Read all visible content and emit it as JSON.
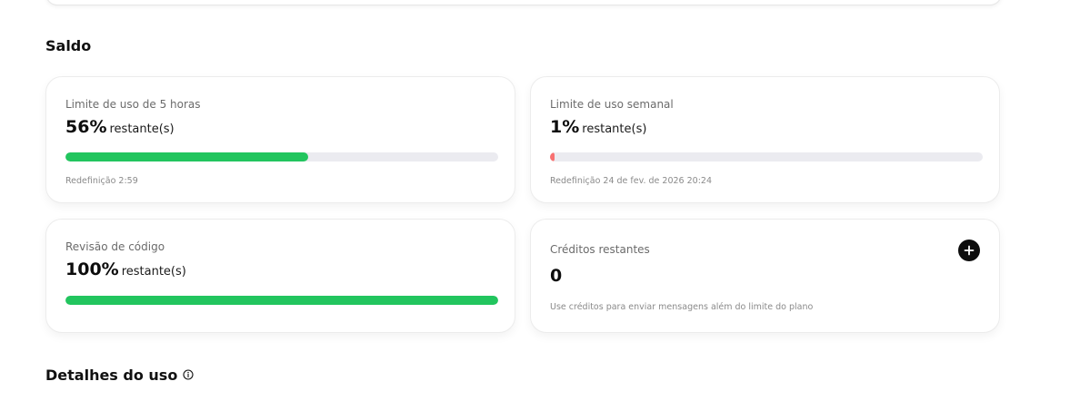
{
  "sections": {
    "balance_title": "Saldo",
    "usage_details_title": "Detalhes do uso"
  },
  "cards": {
    "five_hour": {
      "label": "Limite de uso de 5 horas",
      "percent": "56%",
      "suffix": "restante(s)",
      "remaining_fraction": 0.56,
      "bar_color": "#22c55e",
      "reset": "Redefinição 2:59"
    },
    "weekly": {
      "label": "Limite de uso semanal",
      "percent": "1%",
      "suffix": "restante(s)",
      "remaining_fraction": 0.01,
      "bar_color": "#f87171",
      "reset": "Redefinição 24 de fev. de 2026 20:24"
    },
    "code_review": {
      "label": "Revisão de código",
      "percent": "100%",
      "suffix": "restante(s)",
      "remaining_fraction": 1.0,
      "bar_color": "#22c55e"
    },
    "credits": {
      "label": "Créditos restantes",
      "value": "0",
      "description": "Use créditos para enviar mensagens além do limite do plano",
      "add_icon": "plus-icon"
    }
  },
  "colors": {
    "track": "#ebebf0",
    "success": "#22c55e",
    "danger": "#f87171",
    "primary_dark": "#0d0d0d"
  }
}
